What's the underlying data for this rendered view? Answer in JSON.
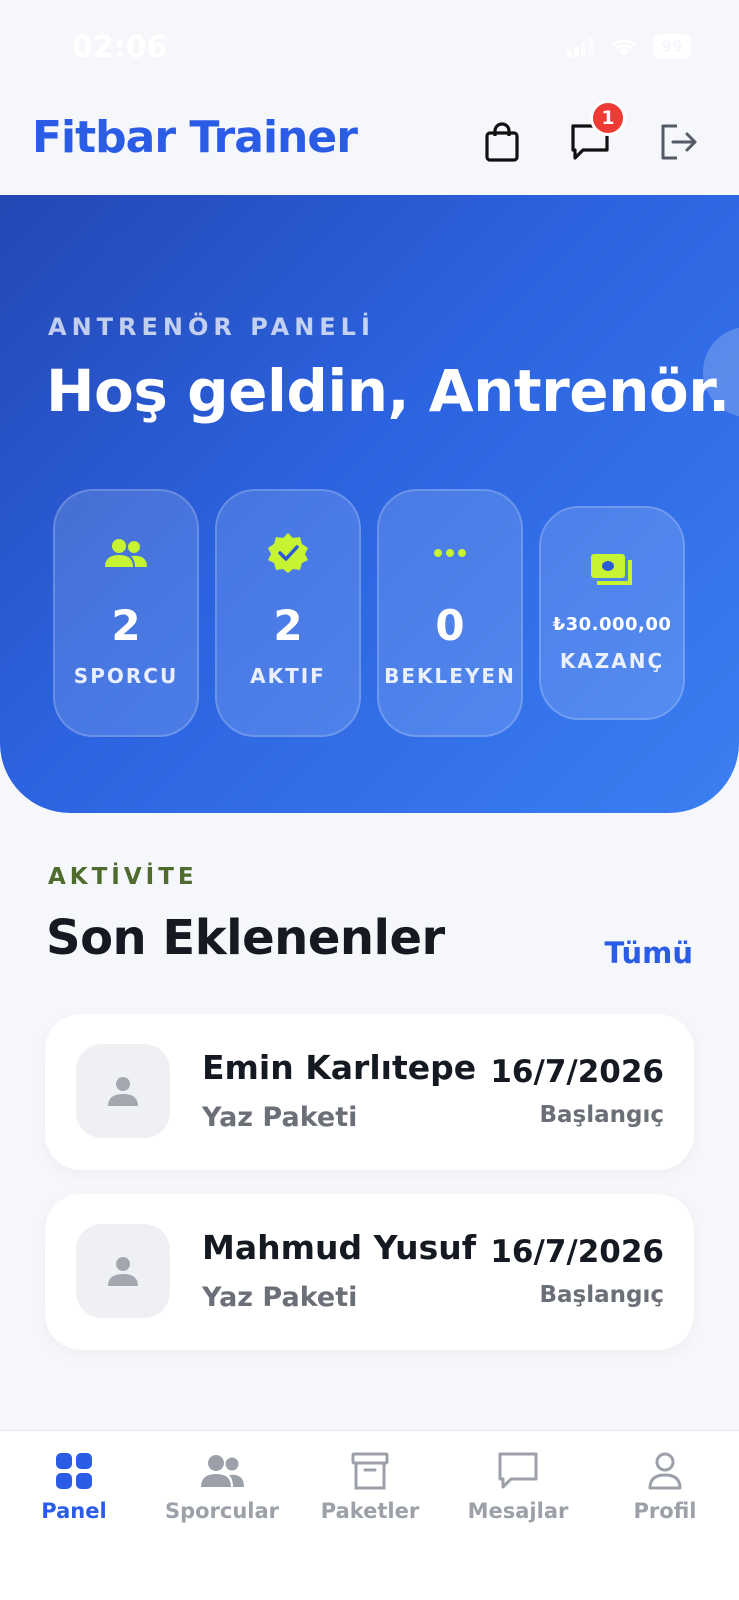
{
  "status_bar": {
    "time": "02:06",
    "battery": "99"
  },
  "header": {
    "title": "Fitbar Trainer",
    "messages_badge": "1",
    "icons": [
      "shopping-bag-icon",
      "message-icon",
      "logout-icon"
    ]
  },
  "hero": {
    "eyebrow": "ANTRENÖR PANELİ",
    "greeting": "Hoş geldin, Antrenör. 👋",
    "stats": [
      {
        "icon": "group-icon",
        "value": "2",
        "label": "SPORCU"
      },
      {
        "icon": "verified-badge-icon",
        "value": "2",
        "label": "AKTIF"
      },
      {
        "icon": "more-dots-icon",
        "value": "0",
        "label": "BEKLEYEN"
      },
      {
        "icon": "cash-icon",
        "value": "₺30.000,00",
        "label": "KAZANÇ"
      }
    ]
  },
  "activity": {
    "eyebrow": "AKTİVİTE",
    "title": "Son Eklenenler",
    "see_all": "Tümü",
    "entries": [
      {
        "name": "Emin Karlıtepe",
        "package": "Yaz Paketi",
        "date": "16/7/2026",
        "date_label": "Başlangıç"
      },
      {
        "name": "Mahmud Yusuf",
        "package": "Yaz Paketi",
        "date": "16/7/2026",
        "date_label": "Başlangıç"
      }
    ]
  },
  "bottom_nav": {
    "items": [
      {
        "label": "Panel",
        "icon": "grid-icon",
        "active": true
      },
      {
        "label": "Sporcular",
        "icon": "people-icon",
        "active": false
      },
      {
        "label": "Paketler",
        "icon": "archive-box-icon",
        "active": false
      },
      {
        "label": "Mesajlar",
        "icon": "chat-icon",
        "active": false
      },
      {
        "label": "Profil",
        "icon": "person-icon",
        "active": false
      }
    ]
  },
  "colors": {
    "brand_blue": "#2b5ce6",
    "accent_lime": "#c6f432",
    "badge_red": "#ef3b35",
    "eyebrow_green": "#4f6b2d"
  }
}
